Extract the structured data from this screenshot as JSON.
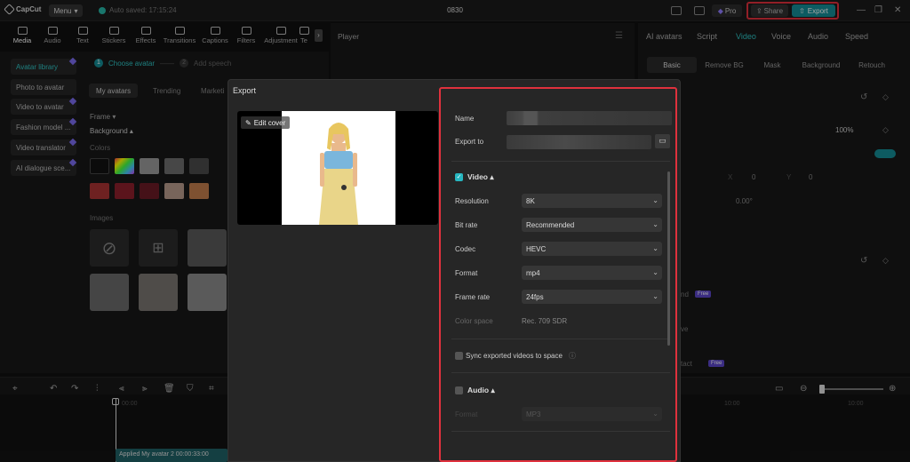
{
  "titlebar": {
    "app_name": "CapCut",
    "menu_label": "Menu",
    "autosave": "Auto saved: 17:15:24",
    "project_title": "0830",
    "pro_label": "Pro",
    "share_label": "Share",
    "export_label": "Export"
  },
  "toolbar": {
    "tools": [
      "Media",
      "Audio",
      "Text",
      "Stickers",
      "Effects",
      "Transitions",
      "Captions",
      "Filters",
      "Adjustment",
      "Te"
    ]
  },
  "left_panel": {
    "sidebar": [
      "Avatar library",
      "Photo to avatar",
      "Video to avatar",
      "Fashion model ...",
      "Video translator",
      "AI dialogue sce..."
    ],
    "step1": "Choose avatar",
    "step2": "Add speech",
    "step1_num": "1",
    "step2_num": "2",
    "tabs": [
      "My avatars",
      "Trending",
      "Marketi"
    ],
    "frame_label": "Frame",
    "background_label": "Background",
    "colors_label": "Colors",
    "images_label": "Images"
  },
  "player": {
    "title": "Player"
  },
  "right_panel": {
    "tabs": [
      "AI avatars",
      "Script",
      "Video",
      "Voice",
      "Audio",
      "Speed"
    ],
    "subtabs": [
      "Basic",
      "Remove BG",
      "Mask",
      "Background",
      "Retouch"
    ],
    "opacity_value": "100%",
    "rotate_value": "0.00°",
    "pos_x_label": "X",
    "pos_x_value": "0",
    "pos_y_label": "Y",
    "pos_y_value": "0",
    "row_fragment_1": "nd",
    "row_fragment_2": "ve",
    "row_fragment_3": "tact",
    "free_badge": "Free"
  },
  "timeline": {
    "clip_label": "Applied  My avatar 2  00:00:33:00",
    "marker": "00:00",
    "time_1": "10:00",
    "time_2": "10:00"
  },
  "export_modal": {
    "title": "Export",
    "edit_cover": "Edit cover",
    "name_label": "Name",
    "export_to_label": "Export to",
    "video_section": "Video",
    "resolution_label": "Resolution",
    "resolution_value": "8K",
    "bitrate_label": "Bit rate",
    "bitrate_value": "Recommended",
    "codec_label": "Codec",
    "codec_value": "HEVC",
    "format_label": "Format",
    "format_value": "mp4",
    "framerate_label": "Frame rate",
    "framerate_value": "24fps",
    "colorspace_label": "Color space",
    "colorspace_value": "Rec. 709 SDR",
    "sync_label": "Sync exported videos to space",
    "audio_section": "Audio",
    "audio_format_label": "Format",
    "audio_format_value": "MP3"
  },
  "colors": {
    "accent": "#148d95",
    "highlight_box": "#e0313d",
    "teal_text": "#2fc4c4"
  }
}
